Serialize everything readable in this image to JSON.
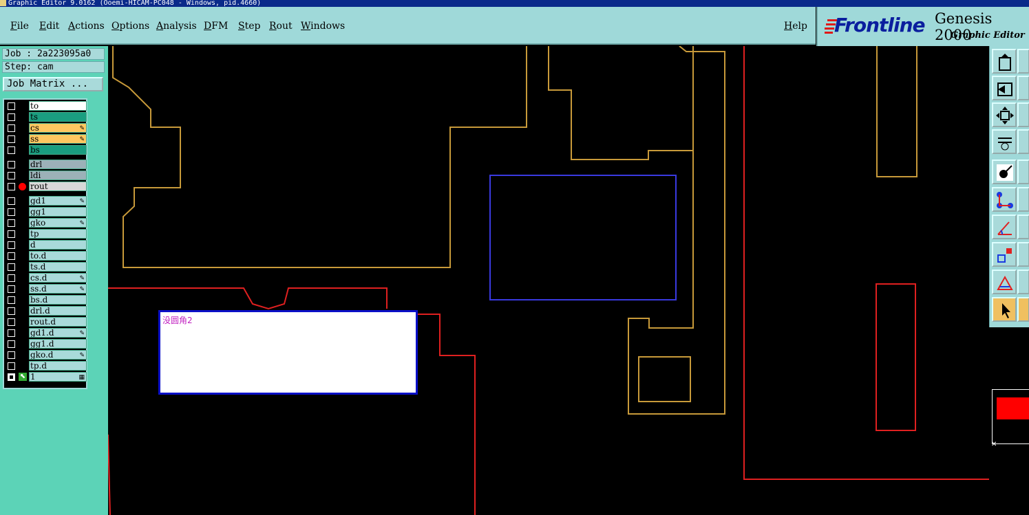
{
  "window": {
    "title": "Graphic Editor 9.0162 (Ooemi-HICAM-PC048 - Windows, pid.4660)"
  },
  "menubar": {
    "items": [
      "File",
      "Edit",
      "Actions",
      "Options",
      "Analysis",
      "DFM",
      "Step",
      "Rout",
      "Windows"
    ],
    "help": "Help"
  },
  "logo": {
    "brand": "Frontline",
    "product": "Genesis 2000",
    "subtitle": "Graphic Editor"
  },
  "job": {
    "label": "Job : 2a223095a0",
    "step": "Step: cam",
    "matrix_button": "Job Matrix ..."
  },
  "layers": [
    {
      "name": "to",
      "color": "#ffffff",
      "group": 1
    },
    {
      "name": "ts",
      "color": "#1a9e80",
      "group": 1
    },
    {
      "name": "cs",
      "color": "#ffc760",
      "group": 1,
      "edit": true
    },
    {
      "name": "ss",
      "color": "#ffc760",
      "group": 1,
      "edit": true
    },
    {
      "name": "bs",
      "color": "#1a9e80",
      "group": 1
    },
    {
      "name": "drl",
      "color": "#9cb1b8",
      "group": 2
    },
    {
      "name": "ldi",
      "color": "#9cb1b8",
      "group": 2
    },
    {
      "name": "rout",
      "color": "#d8d8d8",
      "group": 2,
      "active": true
    },
    {
      "name": "gd1",
      "color": "#a9dada",
      "group": 3,
      "edit": true
    },
    {
      "name": "gg1",
      "color": "#a9dada",
      "group": 3
    },
    {
      "name": "gko",
      "color": "#a9dada",
      "group": 3,
      "edit": true
    },
    {
      "name": "tp",
      "color": "#a9dada",
      "group": 3
    },
    {
      "name": "d",
      "color": "#a9dada",
      "group": 3
    },
    {
      "name": "to.d",
      "color": "#a9dada",
      "group": 3
    },
    {
      "name": "ts.d",
      "color": "#a9dada",
      "group": 3
    },
    {
      "name": "cs.d",
      "color": "#a9dada",
      "group": 3,
      "edit": true
    },
    {
      "name": "ss.d",
      "color": "#a9dada",
      "group": 3,
      "edit": true
    },
    {
      "name": "bs.d",
      "color": "#a9dada",
      "group": 3
    },
    {
      "name": "drl.d",
      "color": "#a9dada",
      "group": 3
    },
    {
      "name": "rout.d",
      "color": "#a9dada",
      "group": 3
    },
    {
      "name": "gd1.d",
      "color": "#a9dada",
      "group": 3,
      "edit": true
    },
    {
      "name": "gg1.d",
      "color": "#a9dada",
      "group": 3
    },
    {
      "name": "gko.d",
      "color": "#a9dada",
      "group": 3,
      "edit": true
    },
    {
      "name": "tp.d",
      "color": "#a9dada",
      "group": 3
    },
    {
      "name": "1",
      "color": "#a9dada",
      "group": 3,
      "selected": true
    }
  ],
  "note": {
    "text": "没圆角2"
  },
  "colors": {
    "outline_gold": "#c89a3a",
    "rout_red": "#e02020",
    "select_blue": "#3a3ae0"
  },
  "toolbar_icons": [
    "zoom-home-icon",
    "zoom-back-icon",
    "fit-screen-icon",
    "tools-icon",
    "snap-icon",
    "measure-icon",
    "line-angle-icon",
    "select-feature-icon",
    "triangle-icon",
    "pointer-icon"
  ]
}
